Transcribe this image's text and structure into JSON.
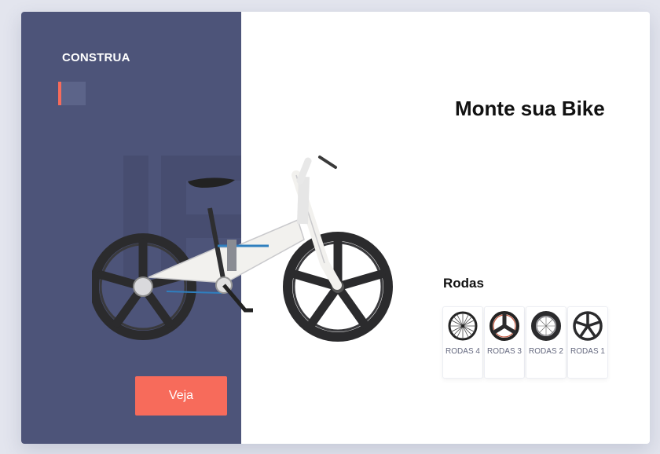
{
  "sidebar": {
    "brand": "CONSTRUA",
    "cta_label": "Veja"
  },
  "main": {
    "title": "Monte sua Bike",
    "section_title": "Rodas",
    "wheels": [
      {
        "label": "RODAS 4",
        "icon": "wheel-spoked-icon"
      },
      {
        "label": "RODAS 3",
        "icon": "wheel-tri-spoke-icon"
      },
      {
        "label": "RODAS 2",
        "icon": "wheel-deep-rim-icon"
      },
      {
        "label": "RODAS 1",
        "icon": "wheel-five-spoke-icon"
      }
    ]
  },
  "colors": {
    "sidebar_bg": "#4d5479",
    "accent": "#f76b5b",
    "page_bg": "#e3e5ee",
    "frame": "#f2f1ee",
    "tire": "#2b2b2d"
  }
}
